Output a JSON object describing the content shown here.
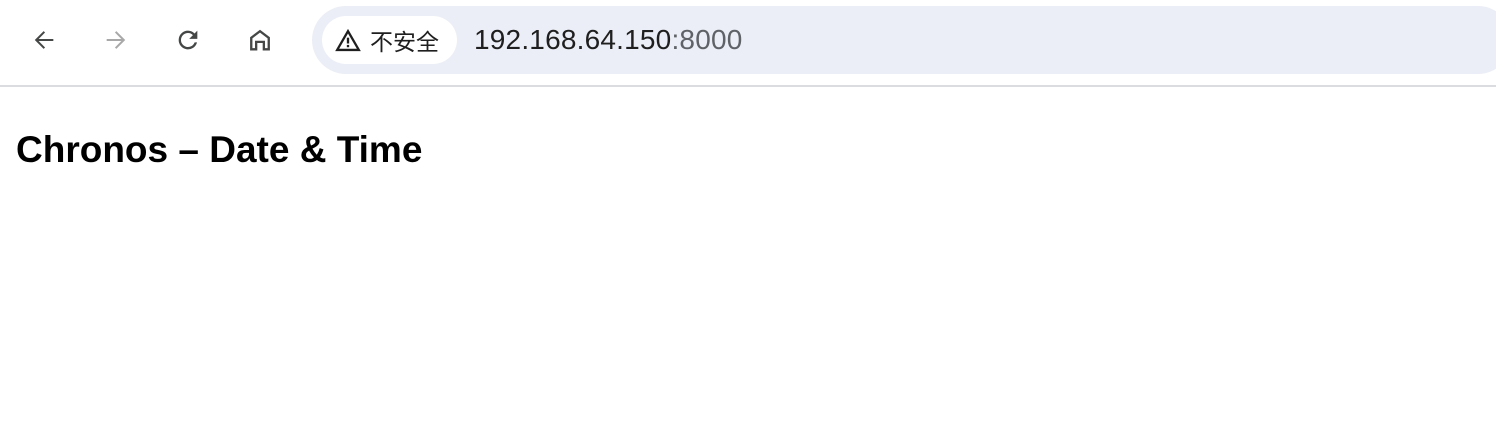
{
  "browser": {
    "nav": {
      "back": {
        "icon": "back-arrow-icon"
      },
      "forward": {
        "icon": "forward-arrow-icon",
        "disabled": true
      },
      "reload": {
        "icon": "reload-icon"
      },
      "home": {
        "icon": "home-icon"
      }
    },
    "omnibox": {
      "security_label": "不安全",
      "security_icon": "warning-triangle-icon",
      "url_host": "192.168.64.150",
      "url_port": ":8000"
    }
  },
  "page": {
    "title": "Chronos – Date & Time"
  },
  "colors": {
    "omnibox_bg": "#ebeef6",
    "icon_active": "#444746",
    "icon_disabled": "#a8a8a8"
  }
}
